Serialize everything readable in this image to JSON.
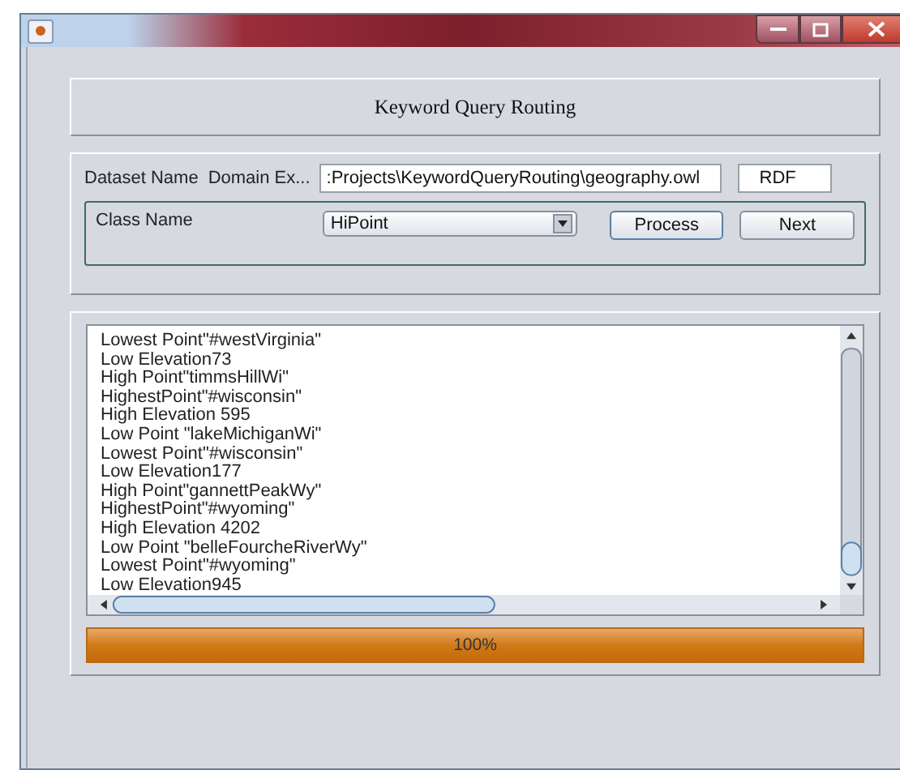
{
  "header": {
    "title": "Keyword Query Routing"
  },
  "dataset": {
    "label": "Dataset Name",
    "domain_label": "Domain Ex...",
    "path": ":Projects\\KeywordQueryRouting\\geography.owl",
    "format": "RDF"
  },
  "class_panel": {
    "label": "Class Name",
    "selected_class": "HiPoint",
    "buttons": [
      {
        "label": "Process",
        "focused": true
      },
      {
        "label": "Next",
        "focused": false
      }
    ]
  },
  "results": [
    "Lowest Point\"#westVirginia\"",
    "Low Elevation73",
    "High Point\"timmsHillWi\"",
    "HighestPoint\"#wisconsin\"",
    "High Elevation 595",
    "Low Point \"lakeMichiganWi\"",
    "Lowest Point\"#wisconsin\"",
    "Low Elevation177",
    "High Point\"gannettPeakWy\"",
    "HighestPoint\"#wyoming\"",
    "High Elevation 4202",
    "Low Point \"belleFourcheRiverWy\"",
    "Lowest Point\"#wyoming\"",
    "Low Elevation945"
  ],
  "progress": {
    "level": 1.0,
    "reading": "100%"
  }
}
